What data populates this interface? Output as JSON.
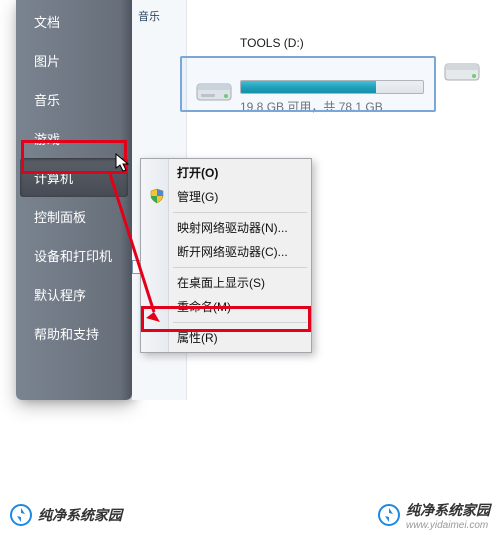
{
  "sidebar": {
    "items": [
      {
        "label": "文档"
      },
      {
        "label": "图片"
      },
      {
        "label": "音乐"
      },
      {
        "label": "游戏"
      },
      {
        "label": "计算机"
      },
      {
        "label": "控制面板"
      },
      {
        "label": "设备和打印机"
      },
      {
        "label": "默认程序"
      },
      {
        "label": "帮助和支持"
      }
    ]
  },
  "drive": {
    "label": "TOOLS (D:)",
    "usage_text": "19.8 GB 可用，共 78.1 GB",
    "fill_percent": 74
  },
  "context_menu": {
    "open": "打开(O)",
    "manage": "管理(G)",
    "map_drive": "映射网络驱动器(N)...",
    "disconnect_drive": "断开网络驱动器(C)...",
    "show_on_desktop": "在桌面上显示(S)",
    "rename": "重命名(M)",
    "properties": "属性(R)"
  },
  "watermark": {
    "left_text": "纯净系统家园",
    "right_text": "纯净系统家园",
    "url": "www.yidaimei.com"
  },
  "explorer_small_sidebar": {
    "music": "音乐"
  }
}
